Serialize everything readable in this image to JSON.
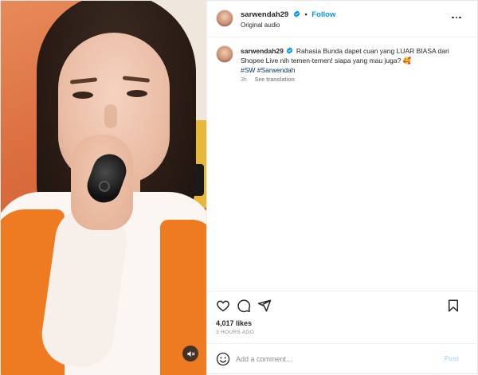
{
  "post": {
    "username": "sarwendah29",
    "follow_label": "Follow",
    "separator": "•",
    "audio_label": "Original audio",
    "caption_text": "Rahasia Bunda dapet cuan yang LUAR BIASA dari Shopee Live nih temen-temen! siapa yang mau juga? 🥰",
    "hashtags": "#SW #Sarwendah",
    "time_ago": "3h",
    "see_translation": "See translation",
    "likes": "4,017 likes",
    "posted_ago": "3 HOURS AGO"
  },
  "comment": {
    "placeholder": "Add a comment...",
    "post_label": "Post"
  },
  "colors": {
    "link_blue": "#0095f6",
    "hashtag": "#00376b",
    "post_disabled": "#b2dffc",
    "vest_orange": "#ee7a22"
  },
  "icons": {
    "verified": "verified-badge-icon",
    "more": "more-options-icon",
    "like": "heart-icon",
    "comment": "comment-icon",
    "share": "send-icon",
    "save": "bookmark-icon",
    "emoji": "emoji-icon",
    "mute": "speaker-muted-icon"
  }
}
